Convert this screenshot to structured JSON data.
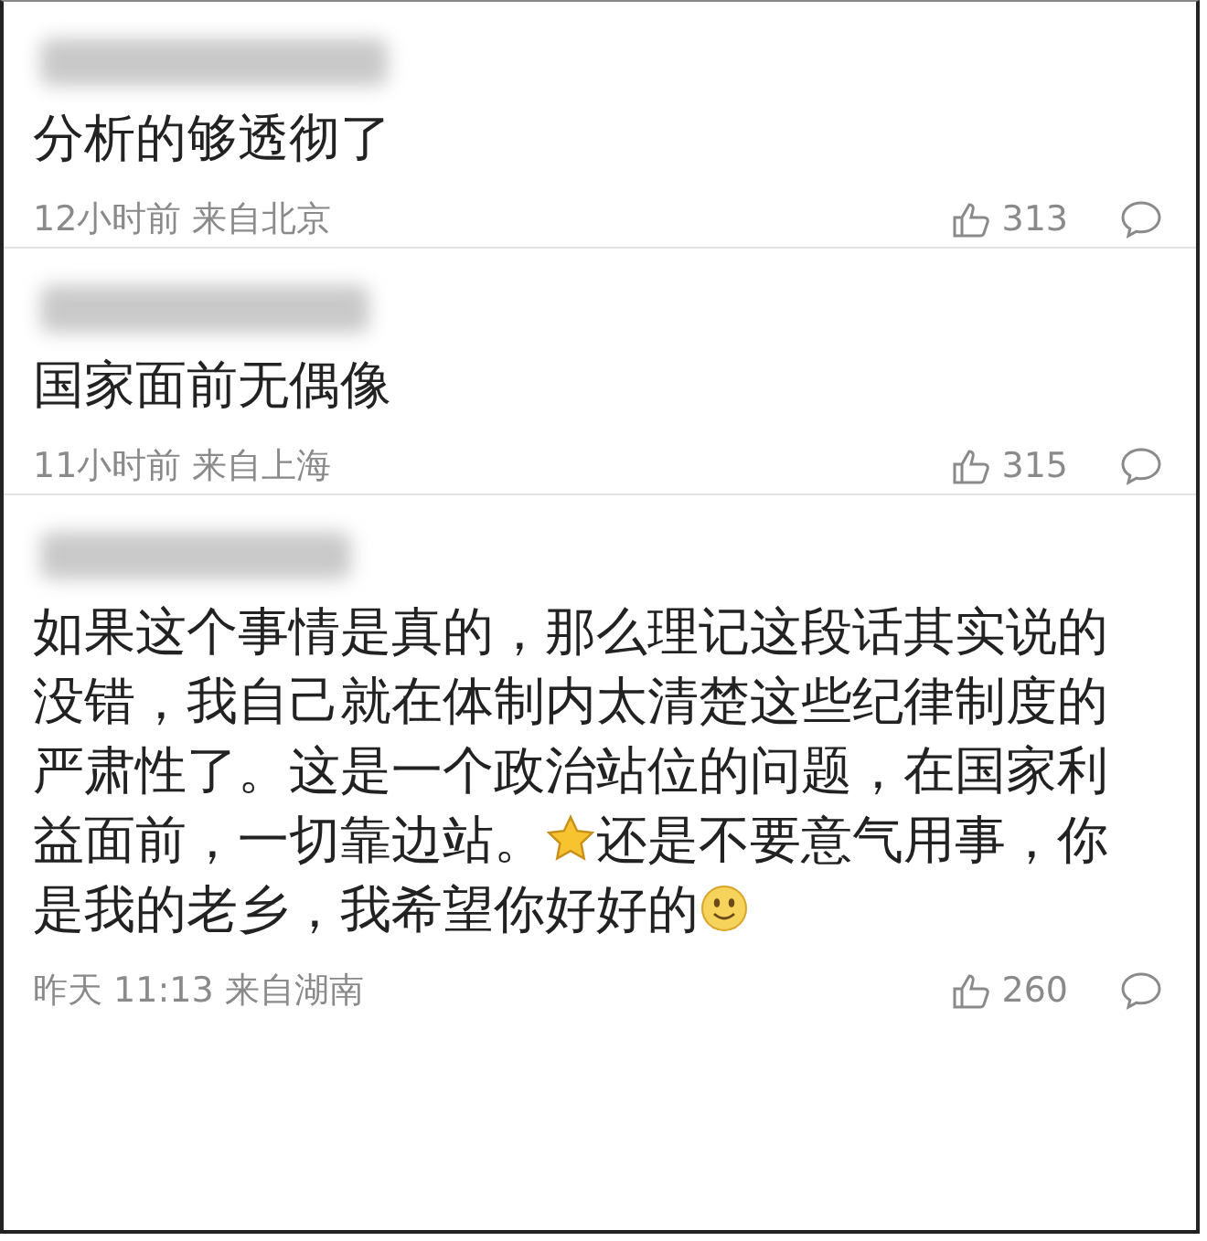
{
  "comments": [
    {
      "body": [
        {
          "kind": "text",
          "text": "分析的够透彻了"
        }
      ],
      "time": "12小时前 来自北京",
      "likes": "313"
    },
    {
      "body": [
        {
          "kind": "text",
          "text": "国家面前无偶像"
        }
      ],
      "time": "11小时前 来自上海",
      "likes": "315"
    },
    {
      "body": [
        {
          "kind": "text",
          "text": "如果这个事情是真的，那么理记这段话其实说的没错，我自己就在体制内太清楚这些纪律制度的严肃性了。这是一个政治站位的问题，在国家利益面前，一切靠边站。"
        },
        {
          "kind": "star"
        },
        {
          "kind": "text",
          "text": "还是不要意气用事，你是我的老乡，我希望你好好的"
        },
        {
          "kind": "smiley"
        }
      ],
      "time": "昨天 11:13 来自湖南",
      "likes": "260"
    }
  ]
}
